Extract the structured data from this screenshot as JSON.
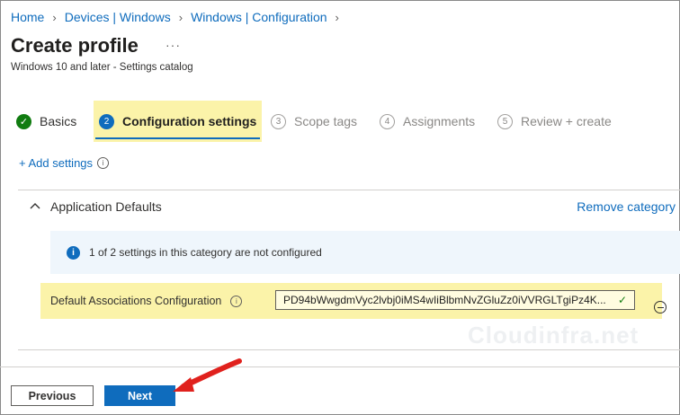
{
  "breadcrumb": [
    "Home",
    "Devices | Windows",
    "Windows | Configuration"
  ],
  "header": {
    "title": "Create profile",
    "more": "···",
    "subtitle": "Windows 10 and later - Settings catalog"
  },
  "steps": [
    {
      "number": "✓",
      "label": "Basics",
      "state": "done"
    },
    {
      "number": "2",
      "label": "Configuration settings",
      "state": "active"
    },
    {
      "number": "3",
      "label": "Scope tags",
      "state": "inactive"
    },
    {
      "number": "4",
      "label": "Assignments",
      "state": "inactive"
    },
    {
      "number": "5",
      "label": "Review + create",
      "state": "inactive"
    }
  ],
  "add_settings": {
    "label": "+ Add settings",
    "info_icon": "i"
  },
  "category": {
    "title": "Application Defaults",
    "remove_label": "Remove category",
    "notice": {
      "icon": "i",
      "text": "1 of 2 settings in this category are not configured"
    },
    "setting": {
      "label": "Default Associations Configuration",
      "info_icon": "i",
      "value": "PD94bWwgdmVyc2lvbj0iMS4wIiBlbmNvZGluZz0iVVRGLTgiPz4K...",
      "check": "✓"
    }
  },
  "watermark": "Cloudinfra.net",
  "footer": {
    "previous_label": "Previous",
    "next_label": "Next"
  },
  "colors": {
    "accent": "#0f6cbd",
    "highlight": "#fbf3a9",
    "success": "#107c10",
    "arrow": "#e0211d"
  }
}
